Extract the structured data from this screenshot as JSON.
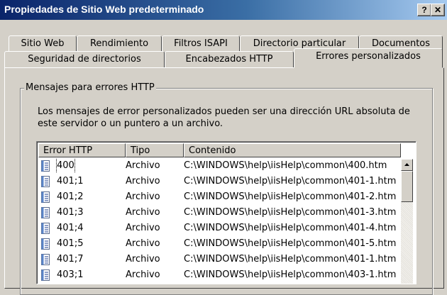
{
  "window": {
    "title": "Propiedades de Sitio Web predeterminado",
    "help_button": "?",
    "close_button": "✕"
  },
  "tabs_row1": [
    {
      "label": "Sitio Web"
    },
    {
      "label": "Rendimiento"
    },
    {
      "label": "Filtros ISAPI"
    },
    {
      "label": "Directorio particular"
    },
    {
      "label": "Documentos"
    }
  ],
  "tabs_row2": [
    {
      "label": "Seguridad de directorios"
    },
    {
      "label": "Encabezados HTTP"
    },
    {
      "label": "Errores personalizados"
    }
  ],
  "active_tab": "Errores personalizados",
  "group": {
    "label": "Mensajes para errores HTTP",
    "description": "Los mensajes de error personalizados pueden ser una dirección URL absoluta de este servidor o un puntero a un archivo."
  },
  "list": {
    "columns": [
      "Error HTTP",
      "Tipo",
      "Contenido"
    ],
    "rows": [
      {
        "error": "400",
        "tipo": "Archivo",
        "contenido": "C:\\WINDOWS\\help\\iisHelp\\common\\400.htm"
      },
      {
        "error": "401;1",
        "tipo": "Archivo",
        "contenido": "C:\\WINDOWS\\help\\iisHelp\\common\\401-1.htm"
      },
      {
        "error": "401;2",
        "tipo": "Archivo",
        "contenido": "C:\\WINDOWS\\help\\iisHelp\\common\\401-2.htm"
      },
      {
        "error": "401;3",
        "tipo": "Archivo",
        "contenido": "C:\\WINDOWS\\help\\iisHelp\\common\\401-3.htm"
      },
      {
        "error": "401;4",
        "tipo": "Archivo",
        "contenido": "C:\\WINDOWS\\help\\iisHelp\\common\\401-4.htm"
      },
      {
        "error": "401;5",
        "tipo": "Archivo",
        "contenido": "C:\\WINDOWS\\help\\iisHelp\\common\\401-5.htm"
      },
      {
        "error": "401;7",
        "tipo": "Archivo",
        "contenido": "C:\\WINDOWS\\help\\iisHelp\\common\\401-1.htm"
      },
      {
        "error": "403;1",
        "tipo": "Archivo",
        "contenido": "C:\\WINDOWS\\help\\iisHelp\\common\\403-1.htm"
      }
    ]
  },
  "colors": {
    "title_start": "#0a246a",
    "title_end": "#a6caf0",
    "face": "#d4d0c8"
  },
  "icons": {
    "row_icon": "document-icon",
    "scroll_up": "arrow-up-icon"
  }
}
